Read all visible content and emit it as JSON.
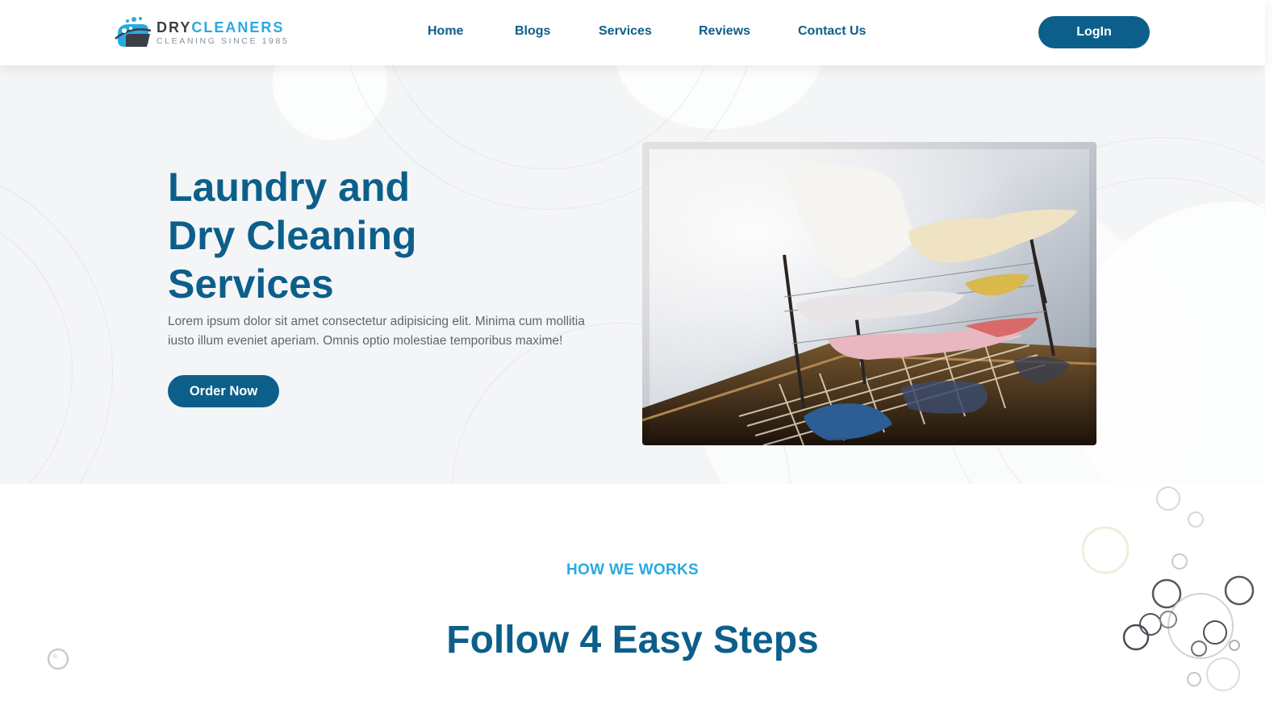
{
  "brand": {
    "name_part1": "DRY",
    "name_part2": "CLEANERS",
    "tagline": "CLEANING SINCE 1985",
    "accent_color": "#29a9e1",
    "primary_color": "#0c5f8a"
  },
  "nav": {
    "items": [
      {
        "label": "Home"
      },
      {
        "label": "Blogs"
      },
      {
        "label": "Services"
      },
      {
        "label": "Reviews"
      },
      {
        "label": "Contact Us"
      }
    ],
    "login_label": "LogIn"
  },
  "hero": {
    "title_lines": [
      "Laundry and",
      "Dry Cleaning",
      "Services"
    ],
    "description": "Lorem ipsum dolor sit amet consectetur adipisicing elit. Minima cum mollitia iusto illum eveniet aperiam. Omnis optio molestiae temporibus maxime!",
    "cta_label": "Order Now",
    "image_icon": "laundry-photo"
  },
  "how_we_work": {
    "eyebrow": "HOW WE WORKS",
    "title": "Follow 4 Easy Steps"
  }
}
